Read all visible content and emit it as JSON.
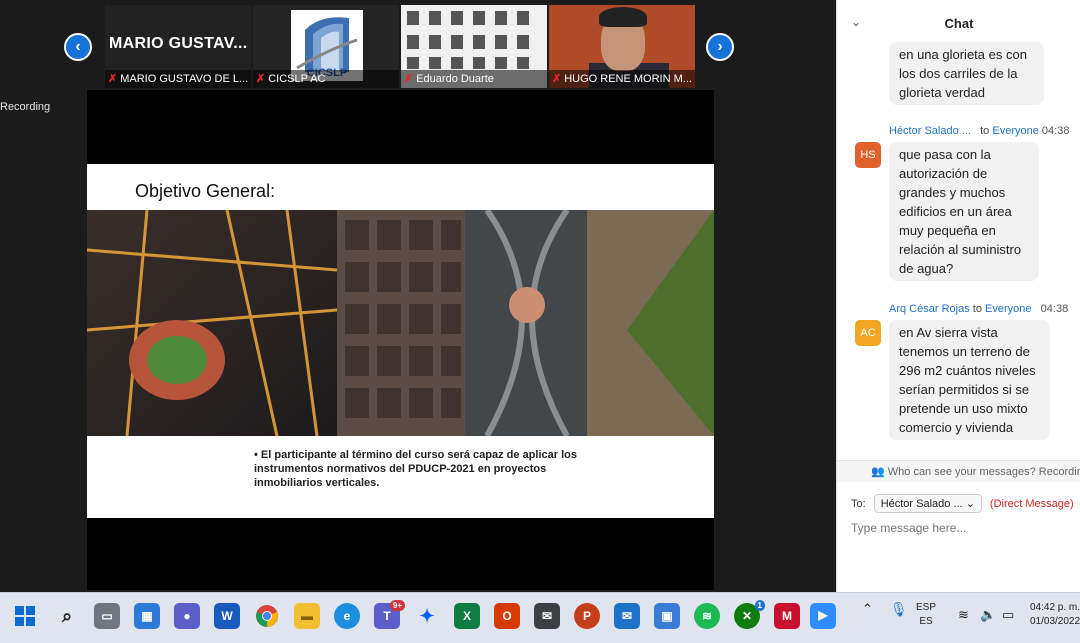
{
  "meeting": {
    "recording_label": "Recording",
    "participants": [
      {
        "display": "MARIO  GUSTAV...",
        "caption": "MARIO GUSTAVO DE L..."
      },
      {
        "caption": "CICSLP AC",
        "logo_text": "CICSLP"
      },
      {
        "caption": "Eduardo Duarte"
      },
      {
        "caption": "HUGO RENE MORIN M..."
      }
    ]
  },
  "slide": {
    "title": "Objetivo General:",
    "bullet": "El participante al término del curso será capaz de aplicar los instrumentos normativos del PDUCP-2021 en proyectos inmobiliarios verticales."
  },
  "chat": {
    "title": "Chat",
    "messages": [
      {
        "text": "en una glorieta es con los dos carriles de la glorieta verdad"
      },
      {
        "sender": "Héctor Salado ...",
        "to_prefix": "to",
        "to": "Everyone",
        "time": "04:38",
        "initials": "HS",
        "text": "que pasa con la autorización de grandes y muchos edificios en un área muy pequeña en relación al suministro de agua?"
      },
      {
        "sender": "Arq César Rojas",
        "to_prefix": "to",
        "to": "Everyone",
        "time": "04:38",
        "initials": "AC",
        "text": "en Av sierra vista tenemos un terreno de 296 m2 cuántos niveles serían permitidos si se pretende un uso mixto comercio y vivienda"
      }
    ],
    "visibility_note": "Who can see your messages? Recording",
    "to_label": "To:",
    "recipient": "Héctor Salado ...",
    "direct": "(Direct Message)",
    "placeholder": "Type message here..."
  },
  "taskbar": {
    "teams_badge": "9+",
    "xbox_badge": "1",
    "lang_top": "ESP",
    "lang_bottom": "ES",
    "time": "04:42 p. m.",
    "date": "01/03/2022"
  },
  "colors": {
    "accent": "#1472d8",
    "chat_link": "#1f72c9",
    "direct": "#d0281e"
  }
}
